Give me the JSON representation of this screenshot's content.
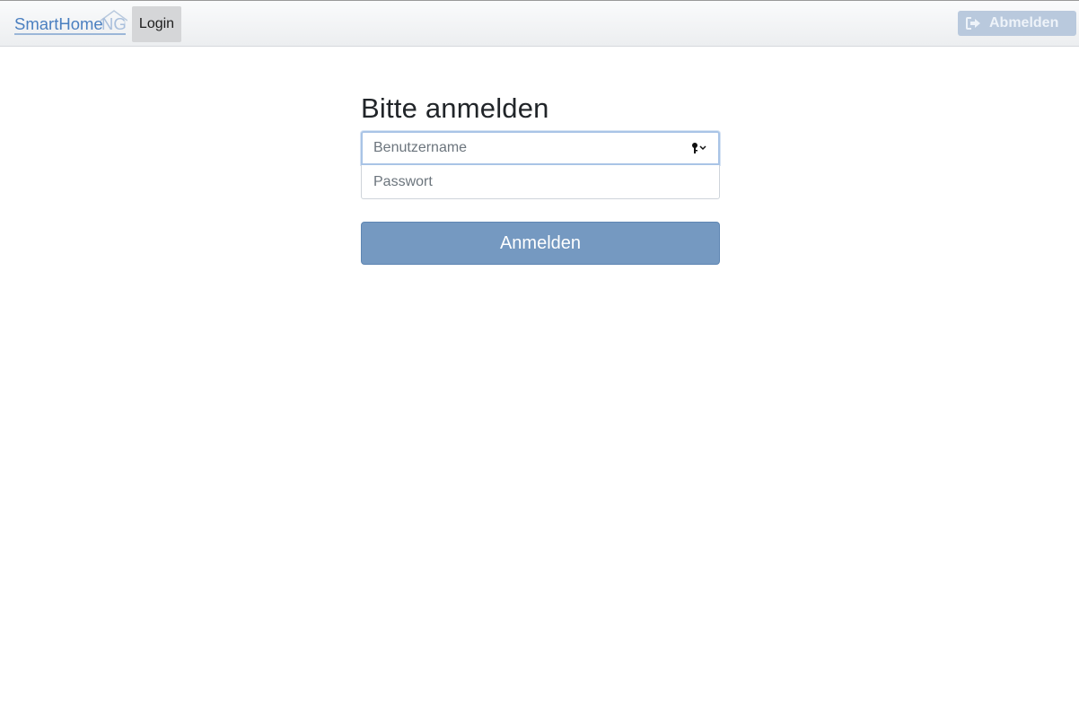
{
  "navbar": {
    "brand_logo_text": "SmartHomeNG",
    "active_item": "Login",
    "logout_label": "Abmelden"
  },
  "login": {
    "title": "Bitte anmelden",
    "username_placeholder": "Benutzername",
    "password_placeholder": "Passwort",
    "submit_label": "Anmelden"
  },
  "icons": {
    "logout": "sign-out-icon",
    "keychain": "key-icon",
    "logo_house": "house-roof-icon"
  },
  "colors": {
    "brand": "#4a7fc0",
    "primary_button": "#7599c1",
    "logout_button": "#b9c9dd",
    "focus_border": "#a9c4e6"
  }
}
